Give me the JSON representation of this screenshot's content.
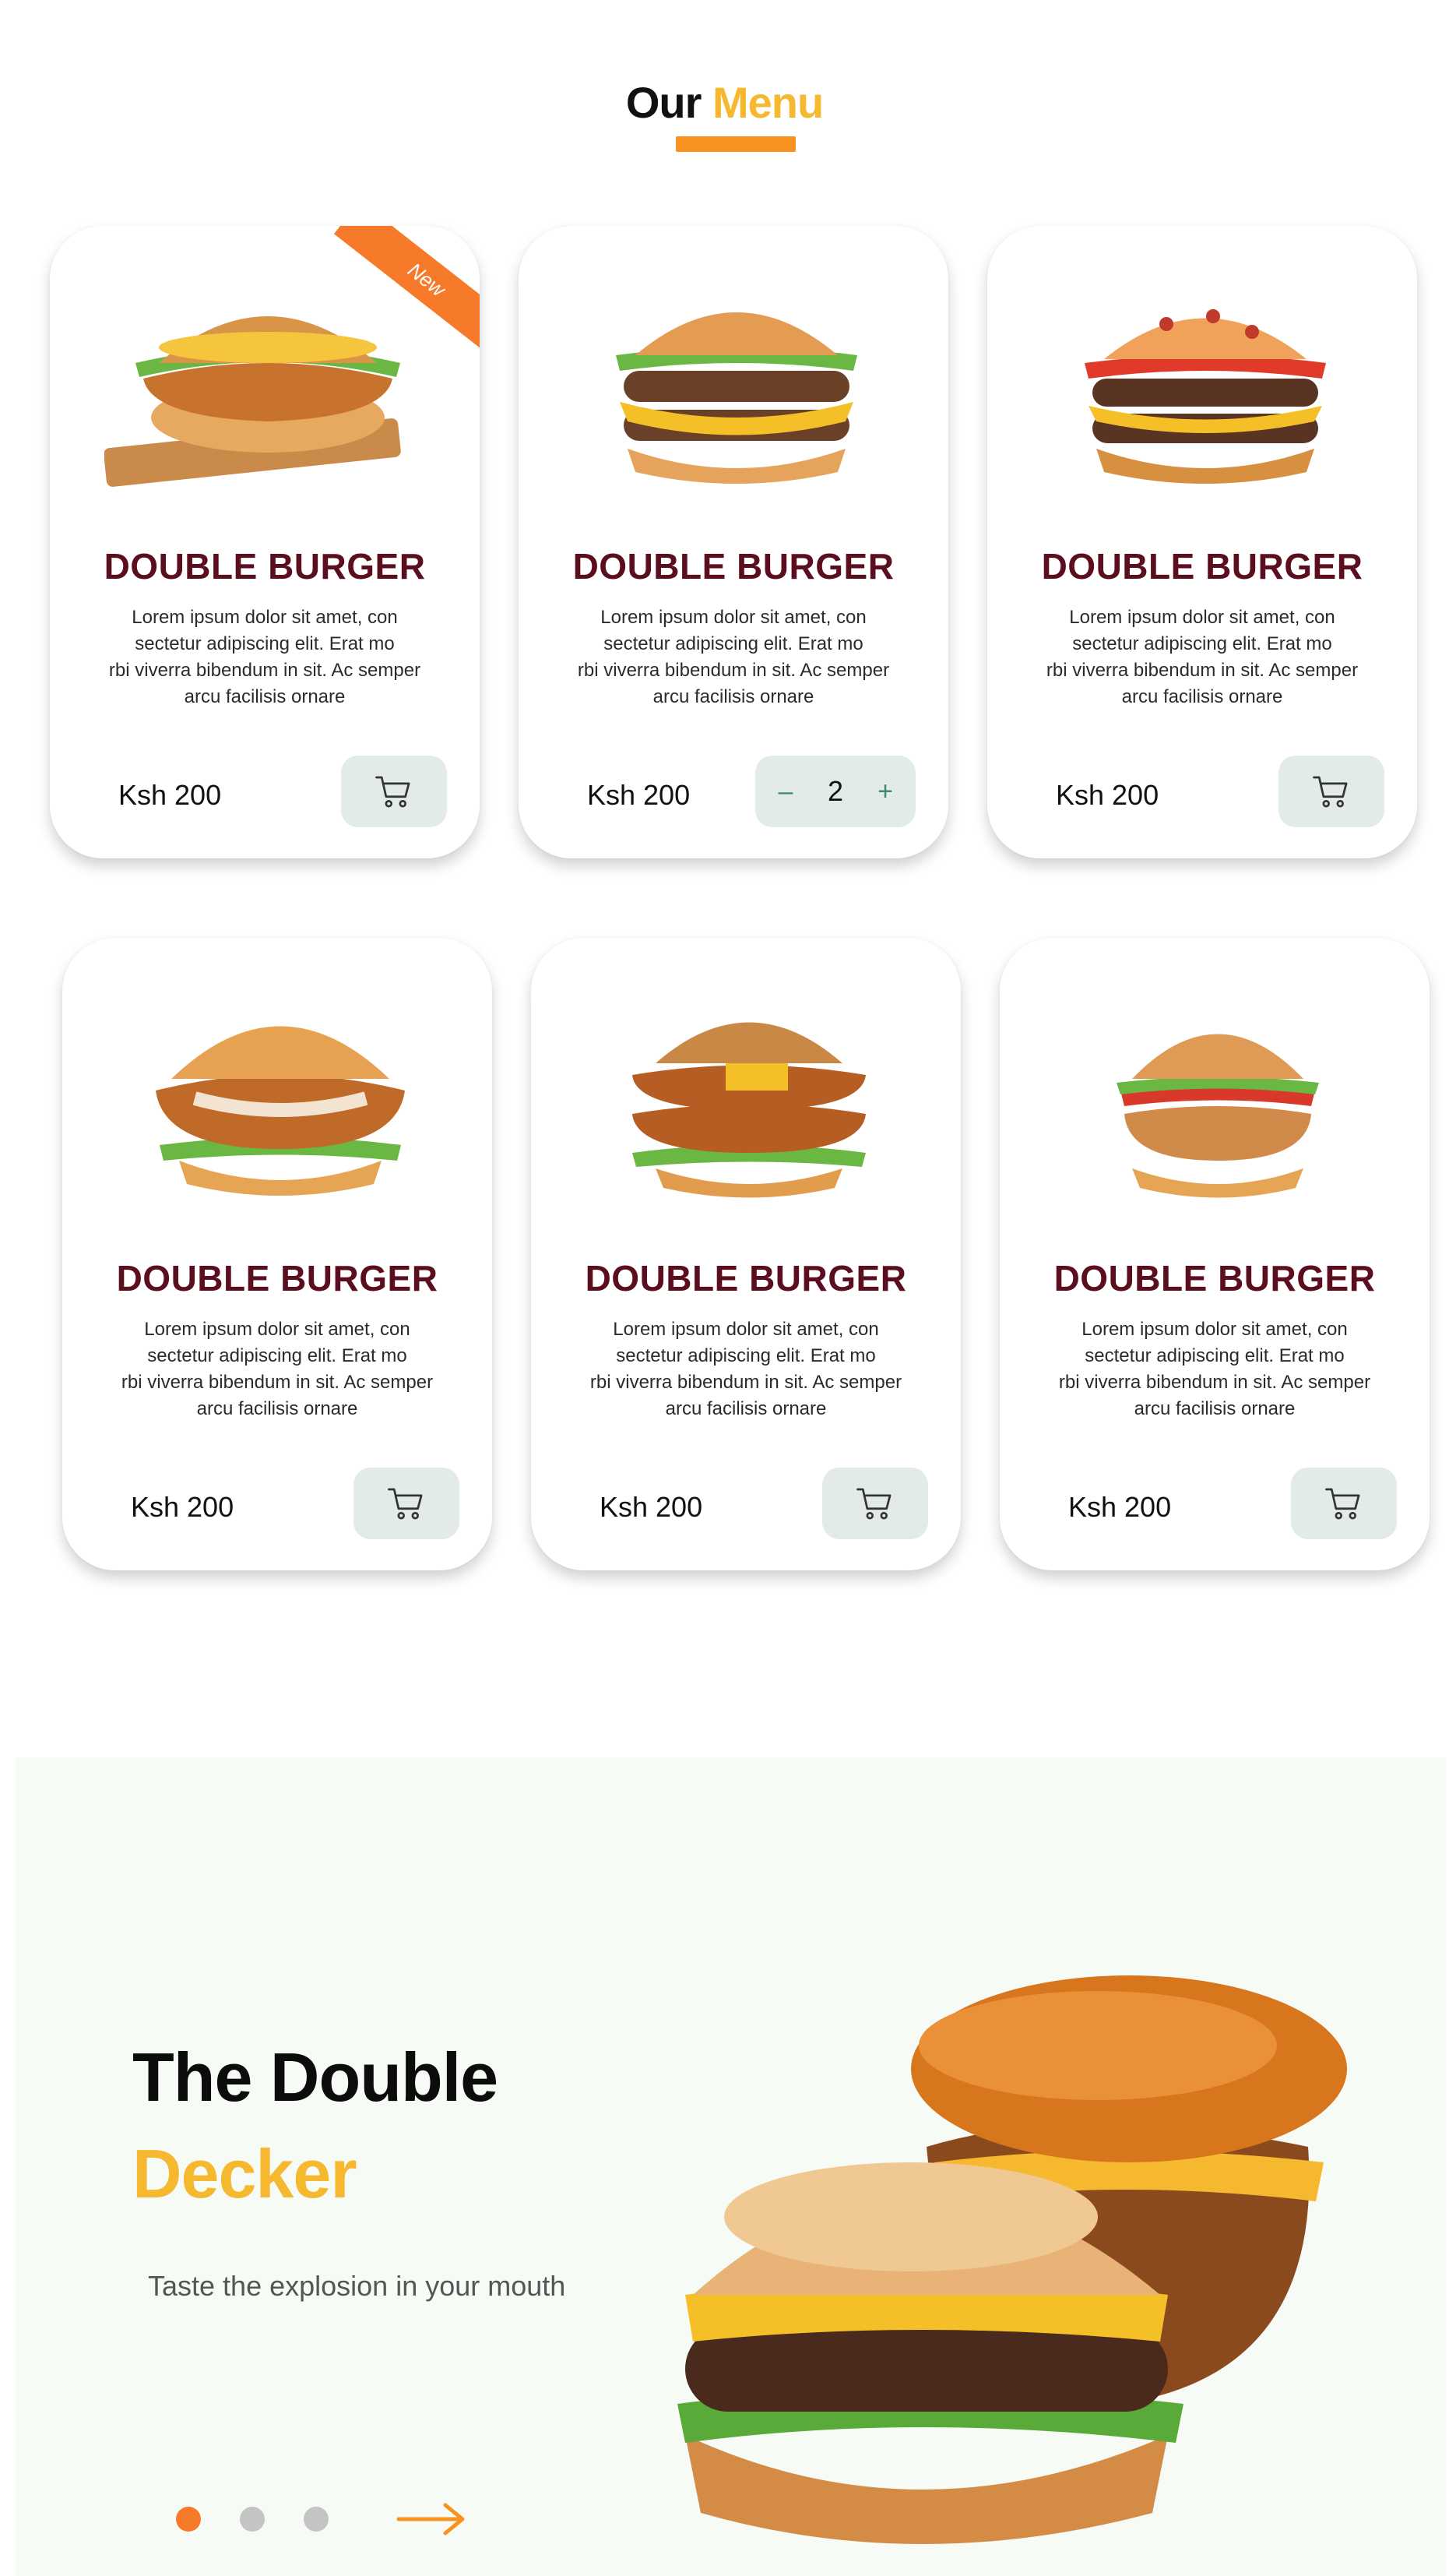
{
  "menu_title": {
    "part1": "Our",
    "part2": "Menu"
  },
  "accent_colors": {
    "orange": "#f7931e",
    "yellow": "#f5b82e",
    "maroon": "#5a0e1e",
    "button_bg": "#e3ebe8"
  },
  "cards": [
    {
      "name": "DOUBLE BURGER",
      "desc": [
        "Lorem ipsum dolor sit amet, con",
        "sectetur adipiscing elit. Erat mo",
        "rbi viverra bibendum in sit. Ac semper",
        "arcu facilisis ornare"
      ],
      "price": "Ksh 200",
      "badge": "New",
      "action": "cart",
      "icon": "cart-icon"
    },
    {
      "name": "DOUBLE BURGER",
      "desc": [
        "Lorem ipsum dolor sit amet, con",
        "sectetur adipiscing elit. Erat mo",
        "rbi viverra bibendum in sit. Ac semper",
        "arcu facilisis ornare"
      ],
      "price": "Ksh 200",
      "action": "stepper",
      "stepper": {
        "minus": "–",
        "qty": "2",
        "plus": "+"
      }
    },
    {
      "name": "DOUBLE BURGER",
      "desc": [
        "Lorem ipsum dolor sit amet, con",
        "sectetur adipiscing elit. Erat mo",
        "rbi viverra bibendum in sit. Ac semper",
        "arcu facilisis ornare"
      ],
      "price": "Ksh 200",
      "action": "cart",
      "icon": "cart-icon"
    },
    {
      "name": "DOUBLE BURGER",
      "desc": [
        "Lorem ipsum dolor sit amet, con",
        "sectetur adipiscing elit. Erat mo",
        "rbi viverra bibendum in sit. Ac semper",
        "arcu facilisis ornare"
      ],
      "price": "Ksh 200",
      "action": "cart",
      "icon": "cart-icon"
    },
    {
      "name": "DOUBLE BURGER",
      "desc": [
        "Lorem ipsum dolor sit amet, con",
        "sectetur adipiscing elit. Erat mo",
        "rbi viverra bibendum in sit. Ac semper",
        "arcu facilisis ornare"
      ],
      "price": "Ksh 200",
      "action": "cart",
      "icon": "cart-icon"
    },
    {
      "name": "DOUBLE BURGER",
      "desc": [
        "Lorem ipsum dolor sit amet, con",
        "sectetur adipiscing elit. Erat mo",
        "rbi viverra bibendum in sit. Ac semper",
        "arcu facilisis ornare"
      ],
      "price": "Ksh 200",
      "action": "cart",
      "icon": "cart-icon"
    }
  ],
  "hero": {
    "title_line1": "The Double",
    "title_line2": "Decker",
    "tagline": "Taste the explosion in your mouth",
    "slides": {
      "count": 3,
      "active_index": 0
    },
    "next_icon": "arrow-right-icon"
  }
}
